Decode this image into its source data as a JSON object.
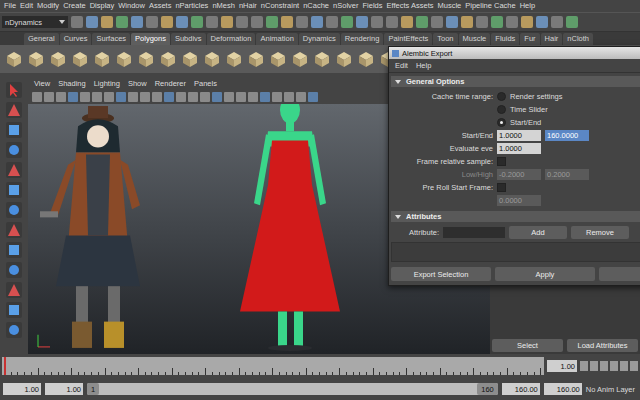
{
  "menu_bar": [
    "File",
    "Edit",
    "Modify",
    "Create",
    "Display",
    "Window",
    "Assets",
    "nParticles",
    "nMesh",
    "nHair",
    "nConstraint",
    "nCache",
    "nSolver",
    "Fields",
    "Effects Assets",
    "Muscle",
    "Pipeline Cache",
    "Help"
  ],
  "status_line": {
    "menu_set": "nDynamics"
  },
  "shelf_tabs": [
    {
      "label": "General",
      "selected": false
    },
    {
      "label": "Curves",
      "selected": false
    },
    {
      "label": "Surfaces",
      "selected": false
    },
    {
      "label": "Polygons",
      "selected": true
    },
    {
      "label": "Subdivs",
      "selected": false
    },
    {
      "label": "Deformation",
      "selected": false
    },
    {
      "label": "Animation",
      "selected": false
    },
    {
      "label": "Dynamics",
      "selected": false
    },
    {
      "label": "Rendering",
      "selected": false
    },
    {
      "label": "PaintEffects",
      "selected": false
    },
    {
      "label": "Toon",
      "selected": false
    },
    {
      "label": "Muscle",
      "selected": false
    },
    {
      "label": "Fluids",
      "selected": false
    },
    {
      "label": "Fur",
      "selected": false
    },
    {
      "label": "Hair",
      "selected": false
    },
    {
      "label": "nCloth",
      "selected": false
    }
  ],
  "panel_menu": [
    "View",
    "Shading",
    "Lighting",
    "Show",
    "Renderer",
    "Panels"
  ],
  "dialog": {
    "title": "Alembic Export",
    "menu": [
      "Edit",
      "Help"
    ],
    "general": {
      "header": "General Options",
      "expanded": true
    },
    "cache_time_range": {
      "label": "Cache time range:",
      "options": [
        {
          "label": "Render settings",
          "selected": false
        },
        {
          "label": "Time Slider",
          "selected": false
        },
        {
          "label": "Start/End",
          "selected": true
        }
      ]
    },
    "rows": [
      {
        "kind": "fields",
        "label": "Start/End",
        "disabled": false,
        "fields": [
          {
            "value": "1.0000",
            "selected": false
          },
          {
            "value": "160.0000",
            "selected": true
          }
        ]
      },
      {
        "kind": "fields",
        "label": "Evaluate eve",
        "disabled": false,
        "fields": [
          {
            "value": "1.0000",
            "selected": false
          }
        ]
      },
      {
        "kind": "checkbox",
        "label": "Frame relative sample:",
        "checked": false
      },
      {
        "kind": "fields",
        "label": "Low/High",
        "disabled": true,
        "fields": [
          {
            "value": "-0.2000",
            "selected": false
          },
          {
            "value": "0.2000",
            "selected": false
          }
        ]
      },
      {
        "kind": "checkbox",
        "label": "Pre Roll Start Frame:",
        "checked": false
      },
      {
        "kind": "fields",
        "label": "",
        "disabled": true,
        "fields": [
          {
            "value": "0.0000",
            "selected": false
          }
        ]
      }
    ],
    "attributes": {
      "header": "Attributes",
      "expanded": true,
      "label": "Attribute:",
      "value": "",
      "buttons": [
        "Add",
        "Remove"
      ]
    },
    "buttons": [
      "Export Selection",
      "Apply"
    ]
  },
  "side_buttons": [
    "Select",
    "Load Attributes"
  ],
  "time_slider": {
    "current_time": "1.00",
    "level": 0
  },
  "range_slider": {
    "start_time": "1.00",
    "range_start": "1.00",
    "handle_start": "1",
    "handle_end": "160",
    "range_end": "160.00",
    "end_time": "160.00",
    "anim_layer": "No Anim Layer"
  }
}
